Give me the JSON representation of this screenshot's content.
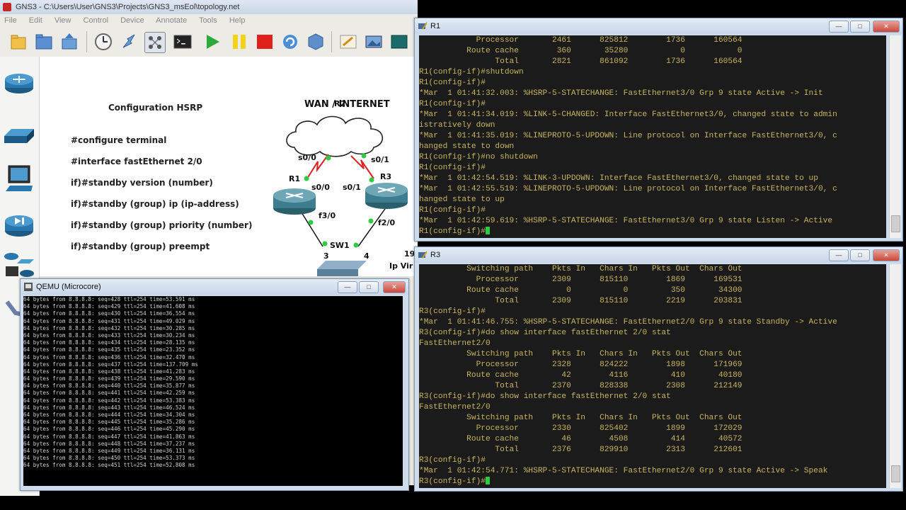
{
  "gns3": {
    "title": "GNS3 - C:\\Users\\User\\GNS3\\Projects\\GNS3_msEol\\topology.net",
    "menu": [
      "File",
      "Edit",
      "View",
      "Control",
      "Device",
      "Annotate",
      "Tools",
      "Help"
    ],
    "toolbar_icons": [
      "new-project-icon",
      "open-project-icon",
      "save-project-icon",
      "snapshot-icon",
      "link-icon",
      "capture-icon",
      "console-icon",
      "start-icon",
      "pause-icon",
      "stop-icon",
      "reload-icon",
      "virtualbox-icon",
      "note-icon",
      "picture-icon",
      "rectangle-icon"
    ],
    "dock_devices": [
      "router-icon",
      "switch-icon",
      "end-device-icon",
      "security-device-icon",
      "all-devices-icon"
    ]
  },
  "topology": {
    "config_title": "Configuration HSRP",
    "config_lines": [
      "#configure terminal",
      "#interface fastEthernet 2/0",
      "if)#standby version (number)",
      "if)#standby (group) ip (ip-address)",
      "if)#standby (group) priority (number)",
      "if)#standby (group) preempt"
    ],
    "cloud_label": "WAN / INTERNET",
    "r2": "R2",
    "r1": "R1",
    "r3": "R3",
    "sw1": "SW1",
    "if_s00_top": "s0/0",
    "if_s01_top": "s0/1",
    "if_s00_r1": "s0/0",
    "if_s01_r3": "s0/1",
    "if_f30": "f3/0",
    "if_f20": "f2/0",
    "sw_port3": "3",
    "sw_port4": "4",
    "partial_right_1": "19",
    "partial_right_2": "Ip Vir"
  },
  "r1_window": {
    "title": "R1",
    "lines": [
      "            Processor       2461      825812        1736      160564",
      "          Route cache        360       35280           0           0",
      "                Total       2821      861092        1736      160564",
      "R1(config-if)#shutdown",
      "R1(config-if)#",
      "*Mar  1 01:41:32.003: %HSRP-5-STATECHANGE: FastEthernet3/0 Grp 9 state Active -> Init",
      "R1(config-if)#",
      "*Mar  1 01:41:34.019: %LINK-5-CHANGED: Interface FastEthernet3/0, changed state to admin",
      "istratively down",
      "*Mar  1 01:41:35.019: %LINEPROTO-5-UPDOWN: Line protocol on Interface FastEthernet3/0, c",
      "hanged state to down",
      "R1(config-if)#no shutdown",
      "R1(config-if)#",
      "*Mar  1 01:42:54.519: %LINK-3-UPDOWN: Interface FastEthernet3/0, changed state to up",
      "*Mar  1 01:42:55.519: %LINEPROTO-5-UPDOWN: Line protocol on Interface FastEthernet3/0, c",
      "hanged state to up",
      "R1(config-if)#",
      "*Mar  1 01:42:59.619: %HSRP-5-STATECHANGE: FastEthernet3/0 Grp 9 state Listen -> Active",
      "R1(config-if)#"
    ]
  },
  "r3_window": {
    "title": "R3",
    "lines": [
      "          Switching path    Pkts In   Chars In   Pkts Out  Chars Out",
      "            Processor       2309      815110        1869      169531",
      "          Route cache          0           0         350       34300",
      "                Total       2309      815110        2219      203831",
      "R3(config-if)#",
      "*Mar  1 01:41:46.755: %HSRP-5-STATECHANGE: FastEthernet2/0 Grp 9 state Standby -> Active",
      "R3(config-if)#do show interface fastEthernet 2/0 stat",
      "FastEthernet2/0",
      "          Switching path    Pkts In   Chars In   Pkts Out  Chars Out",
      "            Processor       2328      824222        1898      171969",
      "          Route cache         42        4116         410       40180",
      "                Total       2370      828338        2308      212149",
      "R3(config-if)#do show interface fastEthernet 2/0 stat",
      "FastEthernet2/0",
      "          Switching path    Pkts In   Chars In   Pkts Out  Chars Out",
      "            Processor       2330      825402        1899      172029",
      "          Route cache         46        4508         414       40572",
      "                Total       2376      829910        2313      212601",
      "R3(config-if)#",
      "*Mar  1 01:42:54.771: %HSRP-5-STATECHANGE: FastEthernet2/0 Grp 9 state Active -> Speak",
      "R3(config-if)#"
    ]
  },
  "qemu_window": {
    "title": "QEMU (Microcore)",
    "lines": [
      "64 bytes from 8.8.8.8: seq=428 ttl=254 time=53.591 ms",
      "64 bytes from 8.8.8.8: seq=429 ttl=254 time=41.608 ms",
      "64 bytes from 8.8.8.8: seq=430 ttl=254 time=36.554 ms",
      "64 bytes from 8.8.8.8: seq=431 ttl=254 time=49.029 ms",
      "64 bytes from 8.8.8.8: seq=432 ttl=254 time=30.285 ms",
      "64 bytes from 8.8.8.8: seq=433 ttl=254 time=30.234 ms",
      "64 bytes from 8.8.8.8: seq=434 ttl=254 time=28.135 ms",
      "64 bytes from 8.8.8.8: seq=435 ttl=254 time=23.352 ms",
      "64 bytes from 8.8.8.8: seq=436 ttl=254 time=32.470 ms",
      "64 bytes from 8.8.8.8: seq=437 ttl=254 time=137.709 ms",
      "64 bytes from 8.8.8.8: seq=438 ttl=254 time=41.283 ms",
      "64 bytes from 8.8.8.8: seq=439 ttl=254 time=29.590 ms",
      "64 bytes from 8.8.8.8: seq=440 ttl=254 time=35.877 ms",
      "64 bytes from 8.8.8.8: seq=441 ttl=254 time=42.259 ms",
      "64 bytes from 8.8.8.8: seq=442 ttl=254 time=53.383 ms",
      "64 bytes from 8.8.8.8: seq=443 ttl=254 time=46.524 ms",
      "64 bytes from 8.8.8.8: seq=444 ttl=254 time=34.304 ms",
      "64 bytes from 8.8.8.8: seq=445 ttl=254 time=35.286 ms",
      "64 bytes from 8.8.8.8: seq=446 ttl=254 time=45.290 ms",
      "64 bytes from 8.8.8.8: seq=447 ttl=254 time=41.863 ms",
      "64 bytes from 8.8.8.8: seq=448 ttl=254 time=37.237 ms",
      "64 bytes from 8.8.8.8: seq=449 ttl=254 time=36.131 ms",
      "64 bytes from 8.8.8.8: seq=450 ttl=254 time=53.373 ms",
      "64 bytes from 8.8.8.8: seq=451 ttl=254 time=52.808 ms"
    ]
  }
}
